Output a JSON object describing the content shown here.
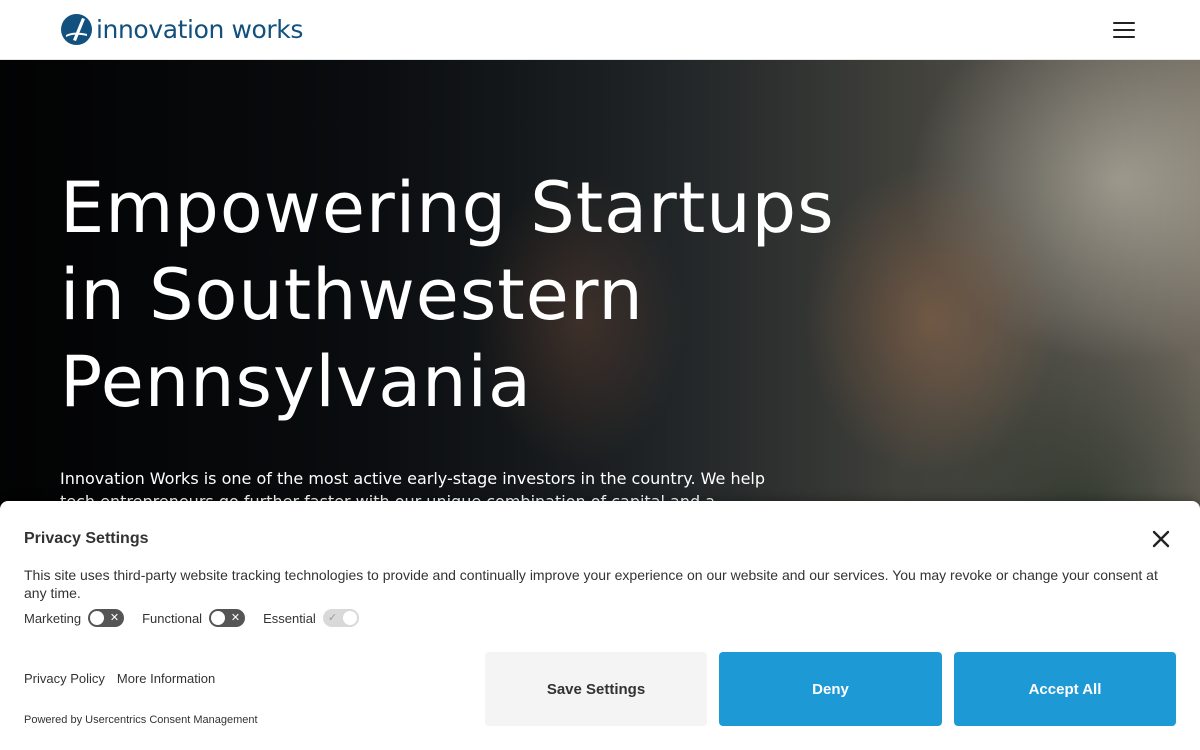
{
  "header": {
    "logo_text": "innovation works",
    "menu_icon": "hamburger-menu-icon",
    "brand_color": "#12517e"
  },
  "hero": {
    "title_lines": [
      "Empowering Startups",
      "in Southwestern",
      "Pennsylvania"
    ],
    "intro": "Innovation Works is one of the most active early-stage investors in the country. We help tech entrepreneurs go further faster with our unique combination of capital and a continuum of"
  },
  "consent": {
    "title": "Privacy Settings",
    "description": "This site uses third-party website tracking technologies to provide and continually improve your experience on our website and our services. You may revoke or change your consent at any time.",
    "toggles": [
      {
        "label": "Marketing",
        "enabled": false
      },
      {
        "label": "Functional",
        "enabled": false
      },
      {
        "label": "Essential",
        "enabled": true
      }
    ],
    "links": {
      "privacy_policy": "Privacy Policy",
      "more_info": "More Information"
    },
    "powered_by": "Powered by Usercentrics Consent Management",
    "buttons": {
      "save": "Save Settings",
      "deny": "Deny",
      "accept": "Accept All"
    },
    "accent_color": "#1d9ad6"
  }
}
